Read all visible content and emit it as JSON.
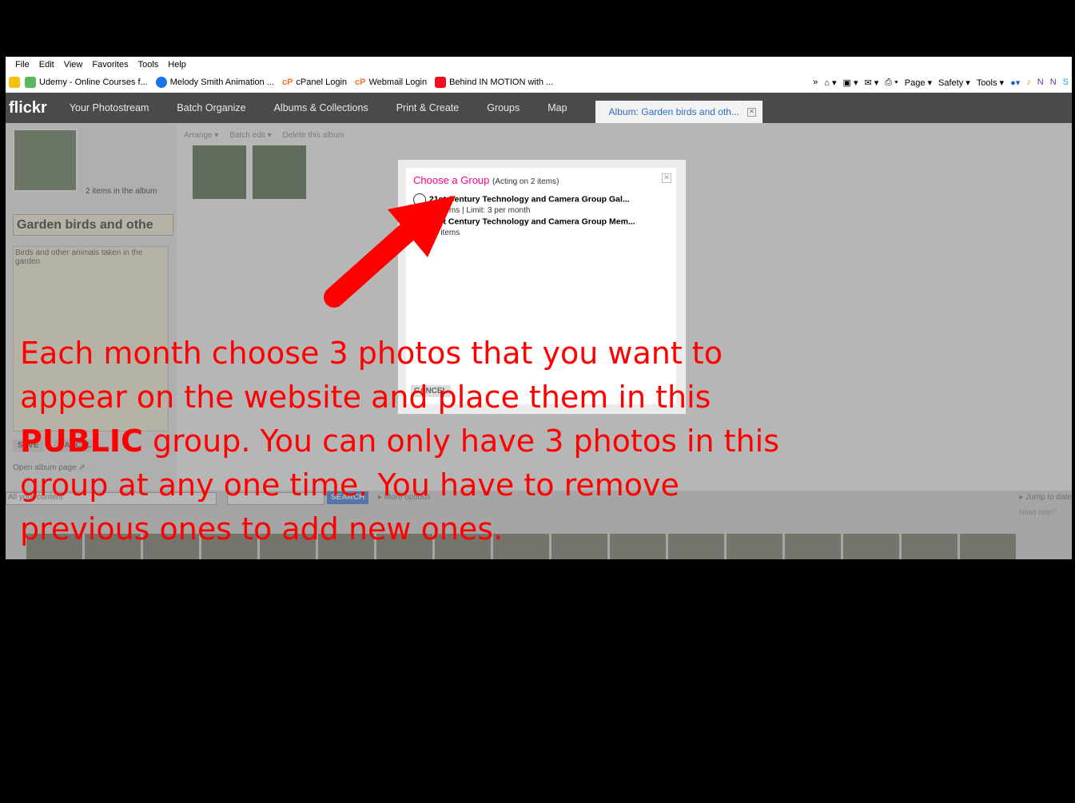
{
  "menu": [
    "File",
    "Edit",
    "View",
    "Favorites",
    "Tools",
    "Help"
  ],
  "favorites": [
    {
      "label": "Udemy - Online Courses f...",
      "icon": "udemy-icon",
      "color": "#5cb85c"
    },
    {
      "label": "Melody Smith Animation ...",
      "icon": "animation-icon",
      "color": "#1a73e8"
    },
    {
      "label": "cPanel Login",
      "icon": "cpanel-icon",
      "color": "#ff6c2c"
    },
    {
      "label": "Webmail Login",
      "icon": "cpanel-icon",
      "color": "#ff6c2c"
    },
    {
      "label": "Behind IN MOTION with ...",
      "icon": "adobe-icon",
      "color": "#e12"
    }
  ],
  "commandbar": {
    "page": "Page ▾",
    "safety": "Safety ▾",
    "tools": "Tools ▾"
  },
  "flickr": {
    "logo": "flickr",
    "nav": [
      "Your Photostream",
      "Batch Organize",
      "Albums & Collections",
      "Print & Create",
      "Groups",
      "Map"
    ],
    "active_tab": "Album: Garden birds and oth..."
  },
  "album": {
    "count_text": "2 items in the album",
    "title": "Garden birds and othe",
    "description": "Birds and other animals taken in the garden",
    "save": "SAVE",
    "cancel": "CANCEL",
    "open_link": "Open album page ⇗",
    "tools": [
      "Arrange ▾",
      "Batch edit ▾",
      "Delete this album"
    ]
  },
  "filmstrip": {
    "select_value": "All your content",
    "search_button": "SEARCH",
    "more_options": "▸ More options",
    "jump": "▸ Jump to date",
    "need_help": "Need help?"
  },
  "modal": {
    "title": "Choose a Group",
    "acting": "(Acting on 2 items)",
    "groups": [
      {
        "name": "21st Century Technology and Camera Group Gal...",
        "sub": "2 items | Limit: 3 per month"
      },
      {
        "name": "21st Century Technology and Camera Group Mem...",
        "sub": "2 items"
      }
    ],
    "cancel": "CANCEL"
  },
  "annotation": {
    "line1": "Each month choose 3 photos that you want to",
    "line2": "appear on the website and place them in this",
    "bold": "PUBLIC",
    "line3_rest": " group. You can only have 3 photos in this",
    "line4": "group at any one time. You have to remove",
    "line5": "previous ones to add new ones.",
    "color": "#ff0000"
  }
}
